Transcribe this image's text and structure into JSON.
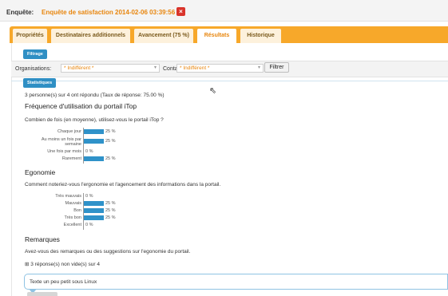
{
  "header": {
    "label": "Enquête:",
    "value": "Enquête de satisfaction 2014-02-06 03:39:56"
  },
  "tabs": [
    {
      "label": "Propriétés",
      "active": false
    },
    {
      "label": "Destinataires additionnels",
      "active": false
    },
    {
      "label": "Avancement (75 %)",
      "active": false
    },
    {
      "label": "Résultats",
      "active": true
    },
    {
      "label": "Historique",
      "active": false
    }
  ],
  "filter": {
    "title": "Filtrage",
    "organisations_label": "Organisations:",
    "organisations_value": "* Indifférent *",
    "contacts_label": "Contacts:",
    "contacts_value": "* Indifférent *",
    "button": "Filtrer"
  },
  "stats": {
    "title": "Statistiques",
    "summary": "3 personne(s) sur 4 ont répondu (Taux de réponse: 75.00 %)"
  },
  "questions": [
    {
      "heading": "Fréquence d'utilisation du portail iTop",
      "question": "Combien de fois (en moyenne), utilisez-vous le portail iTop ?",
      "answers": [
        {
          "label": "Chaque jour",
          "pct": 25,
          "text": "25 %"
        },
        {
          "label": "Au moins un fois par semaine",
          "pct": 25,
          "text": "25 %"
        },
        {
          "label": "Une fois par mois",
          "pct": 0,
          "text": "0 %"
        },
        {
          "label": "Rarement",
          "pct": 25,
          "text": "25 %"
        }
      ]
    },
    {
      "heading": "Egonomie",
      "question": "Comment noteriez-vous l'ergonomie et l'agencement des informations dans la portail.",
      "answers": [
        {
          "label": "Très mauvais",
          "pct": 0,
          "text": "0 %"
        },
        {
          "label": "Mauvais",
          "pct": 25,
          "text": "25 %"
        },
        {
          "label": "Bon",
          "pct": 25,
          "text": "25 %"
        },
        {
          "label": "Très bon",
          "pct": 25,
          "text": "25 %"
        },
        {
          "label": "Excellent",
          "pct": 0,
          "text": "0 %"
        }
      ]
    }
  ],
  "remarks": {
    "heading": "Remarques",
    "question": "Avez-vous des remarques ou des suggestions sur l'egonomie du portail.",
    "toggle": "⊞ 3 réponse(s) non vide(s) sur 4",
    "first_comment": "Texte un peu petit sous Linux"
  },
  "colors": {
    "accent_orange": "#f7a82a",
    "title_orange": "#e8860e",
    "bar_blue": "#2f92c9",
    "pill_blue": "#2f8fc4"
  }
}
